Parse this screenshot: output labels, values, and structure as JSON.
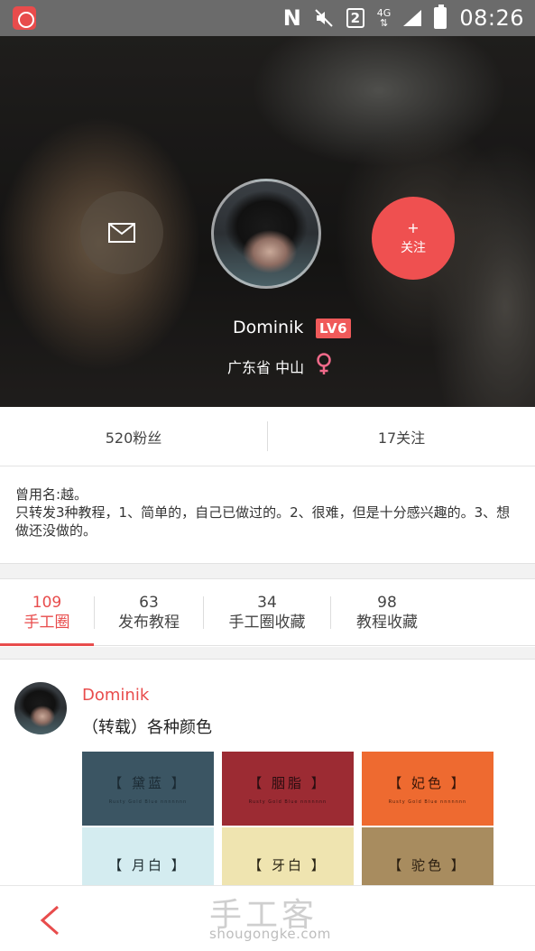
{
  "status_bar": {
    "time": "08:26",
    "sim_slot": "2",
    "network": "4G",
    "icons": [
      "app-icon",
      "n-icon",
      "mute-icon",
      "sim-icon",
      "network-icon",
      "signal-icon",
      "battery-icon"
    ]
  },
  "profile": {
    "username": "Dominik",
    "level": "LV6",
    "location": "广东省 中山",
    "gender_icon": "female-icon",
    "message_icon": "envelope-icon",
    "follow": {
      "plus": "+",
      "label": "关注"
    }
  },
  "stats": {
    "fans": "520粉丝",
    "following": "17关注"
  },
  "bio": {
    "line1": "曾用名:越。",
    "line2": "只转发3种教程，1、简单的，自己已做过的。2、很难，但是十分感兴趣的。3、想做还没做的。"
  },
  "tabs": [
    {
      "count": "109",
      "label": "手工圈",
      "active": true
    },
    {
      "count": "63",
      "label": "发布教程",
      "active": false
    },
    {
      "count": "34",
      "label": "手工圈收藏",
      "active": false
    },
    {
      "count": "98",
      "label": "教程收藏",
      "active": false
    }
  ],
  "post": {
    "author": "Dominik",
    "title": "（转载）各种颜色",
    "swatches": [
      {
        "name": "【 黛蓝 】",
        "sub": "Rusty Gold Blue  nnnnnnn",
        "bg": "#3b5563",
        "fg": "#1b2a33"
      },
      {
        "name": "【 胭脂 】",
        "sub": "Rusty Gold Blue  nnnnnnn",
        "bg": "#9c2b33",
        "fg": "#2a0d10"
      },
      {
        "name": "【 妃色 】",
        "sub": "Rusty Gold Blue  nnnnnnn",
        "bg": "#ee6a30",
        "fg": "#3a1608"
      },
      {
        "name": "【 月白 】",
        "sub": "",
        "bg": "#d4ecf0",
        "fg": "#1c2a2e"
      },
      {
        "name": "【 牙白 】",
        "sub": "",
        "bg": "#efe4b0",
        "fg": "#2a2414"
      },
      {
        "name": "【 驼色 】",
        "sub": "",
        "bg": "#a88c5f",
        "fg": "#2a1e10"
      }
    ]
  },
  "bottom": {
    "back_icon": "chevron-left-icon",
    "watermark": "手工客",
    "watermark_url": "shougongke.com"
  },
  "colors": {
    "accent": "#e84c4c",
    "level_badge": "#f05a5a"
  }
}
